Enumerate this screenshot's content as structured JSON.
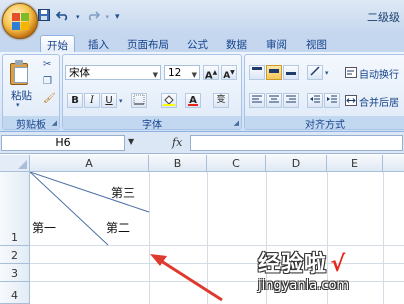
{
  "title_bar": {
    "title": "二级级",
    "save_icon": "save-icon",
    "undo_icon": "undo-icon",
    "redo_icon": "redo-icon",
    "customize_arrow": "▾"
  },
  "tabs": [
    {
      "label": "开始",
      "active": true
    },
    {
      "label": "插入"
    },
    {
      "label": "页面布局"
    },
    {
      "label": "公式"
    },
    {
      "label": "数据"
    },
    {
      "label": "审阅"
    },
    {
      "label": "视图"
    }
  ],
  "ribbon": {
    "clipboard": {
      "paste_label": "粘贴",
      "group_label": "剪贴板"
    },
    "font": {
      "font_name": "宋体",
      "font_size": "12",
      "grow_label": "A",
      "shrink_label": "A",
      "bold": "B",
      "italic": "I",
      "underline": "U",
      "font_color_label": "A",
      "phonetic_label": "变",
      "group_label": "字体"
    },
    "alignment": {
      "wrap_text": "自动换行",
      "merge_center": "合并后居",
      "group_label": "对齐方式"
    }
  },
  "formula_bar": {
    "name_box": "H6",
    "fx_label": "fx",
    "formula": ""
  },
  "columns": [
    "A",
    "B",
    "C",
    "D",
    "E"
  ],
  "rows": [
    "1",
    "2",
    "3",
    "4"
  ],
  "cells": {
    "a1_top_right": "第三",
    "a1_bottom_left": "第一",
    "a1_bottom_middle": "第二"
  },
  "watermark": {
    "text": "经验啦",
    "check": "√",
    "url": "jingyanla.com"
  },
  "colors": {
    "accent": "#15428b",
    "arrow": "#e03a2e",
    "ribbon_bg": "#dbe7f6"
  }
}
